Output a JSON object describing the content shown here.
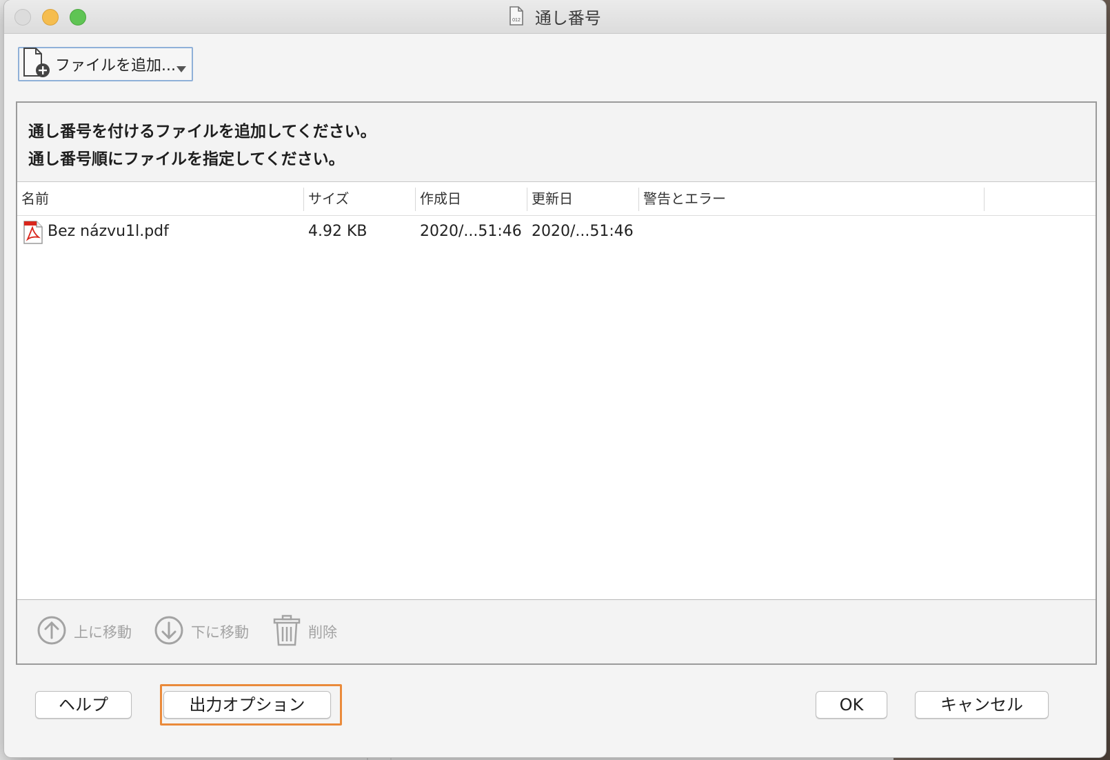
{
  "window": {
    "title": "通し番号",
    "title_icon": "numbered-document-icon"
  },
  "toolbar": {
    "add_file_label": "ファイルを追加...",
    "add_file_icon": "add-file-icon"
  },
  "instructions": {
    "line1": "通し番号を付けるファイルを追加してください。",
    "line2": "通し番号順にファイルを指定してください。"
  },
  "table": {
    "columns": [
      "名前",
      "サイズ",
      "作成日",
      "更新日",
      "警告とエラー"
    ],
    "rows": [
      {
        "name": "Bez názvu1l.pdf",
        "size": "4.92 KB",
        "created": "2020/...51:46",
        "modified": "2020/...51:46",
        "warnings": "",
        "icon": "pdf-file-icon"
      }
    ]
  },
  "list_actions": {
    "move_up": "上に移動",
    "move_down": "下に移動",
    "delete": "削除"
  },
  "buttons": {
    "help": "ヘルプ",
    "output_options": "出力オプション",
    "ok": "OK",
    "cancel": "キャンセル"
  },
  "colors": {
    "focus_ring": "#ea8a3a",
    "selected_border": "#8fb0d8",
    "disabled_text": "#a3a3a3",
    "pdf_red": "#d9261c"
  }
}
